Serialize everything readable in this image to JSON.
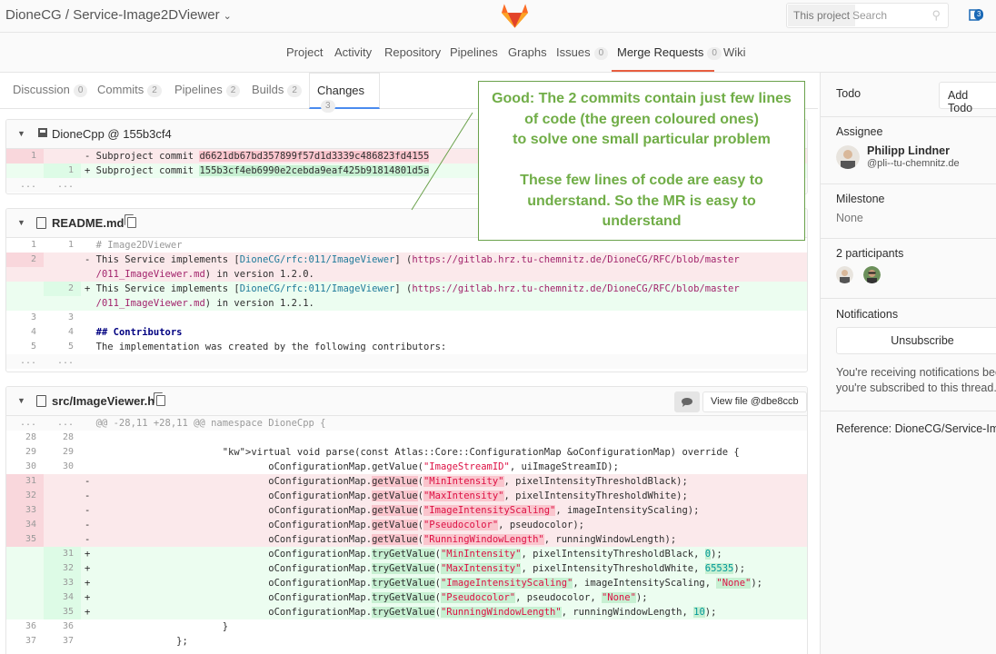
{
  "header": {
    "project_path": "DioneCG / Service-Image2DViewer",
    "scope_label": "This project",
    "search_placeholder": "Search",
    "todo_count": "3"
  },
  "project_nav": {
    "items": [
      {
        "label": "Project"
      },
      {
        "label": "Activity"
      },
      {
        "label": "Repository"
      },
      {
        "label": "Pipelines"
      },
      {
        "label": "Graphs"
      },
      {
        "label": "Issues",
        "count": "0"
      },
      {
        "label": "Merge Requests",
        "count": "0"
      },
      {
        "label": "Wiki"
      }
    ]
  },
  "tabs": [
    {
      "label": "Discussion",
      "count": "0"
    },
    {
      "label": "Commits",
      "count": "2"
    },
    {
      "label": "Pipelines",
      "count": "2"
    },
    {
      "label": "Builds",
      "count": "2"
    },
    {
      "label": "Changes",
      "count": "3"
    }
  ],
  "files": [
    {
      "name": "DioneCpp @ 155b3cf4",
      "lines": [
        {
          "t": "old",
          "o": "1",
          "n": "",
          "pre": "- Subproject commit ",
          "hl": "d6621db67bd357899f57d1d3339c486823fd4155"
        },
        {
          "t": "new",
          "o": "",
          "n": "1",
          "pre": "+ Subproject commit ",
          "hl": "155b3cf4eb6990e2cebda9eaf425b91814801d5a"
        },
        {
          "t": "fold",
          "o": "...",
          "n": "..."
        }
      ]
    },
    {
      "name": "README.md",
      "lines": [
        {
          "o": "1",
          "n": "1",
          "text": "  # Image2DViewer"
        },
        {
          "o": "2",
          "n": "",
          "text": "- This Service implements [DioneCG/rfc:011/ImageViewer] (https://gitlab.hrz.tu-chemnitz.de/DioneCG/RFC/blob/master"
        },
        {
          "o": "",
          "n": "",
          "text": "  /011_ImageViewer.md) in version 1.2.0."
        },
        {
          "o": "",
          "n": "2",
          "text": "+ This Service implements [DioneCG/rfc:011/ImageViewer] (https://gitlab.hrz.tu-chemnitz.de/DioneCG/RFC/blob/master"
        },
        {
          "o": "",
          "n": "",
          "text": "  /011_ImageViewer.md) in version 1.2.1."
        },
        {
          "o": "3",
          "n": "3",
          "text": ""
        },
        {
          "o": "4",
          "n": "4",
          "text": "  ## Contributors"
        },
        {
          "o": "5",
          "n": "5",
          "text": "  The implementation was created by the following contributors:"
        },
        {
          "o": "...",
          "n": "...",
          "text": ""
        }
      ]
    },
    {
      "name": "src/ImageViewer.h",
      "view_label": "View file @dbe8ccb",
      "lines": [
        {
          "o": "...",
          "n": "...",
          "text": "  @@ -28,11 +28,11 @@ namespace DioneCpp {"
        },
        {
          "o": "28",
          "n": "28",
          "text": ""
        },
        {
          "o": "29",
          "n": "29",
          "text": "                        virtual void parse(const Atlas::Core::ConfigurationMap &oConfigurationMap) override {"
        },
        {
          "o": "30",
          "n": "30",
          "text": "                                oConfigurationMap.getValue(\"ImageStreamID\", uiImageStreamID);"
        },
        {
          "o": "31",
          "n": "",
          "text": "-                               oConfigurationMap.getValue(\"MinIntensity\", pixelIntensityThresholdBlack);"
        },
        {
          "o": "32",
          "n": "",
          "text": "-                               oConfigurationMap.getValue(\"MaxIntensity\", pixelIntensityThresholdWhite);"
        },
        {
          "o": "33",
          "n": "",
          "text": "-                               oConfigurationMap.getValue(\"ImageIntensityScaling\", imageIntensityScaling);"
        },
        {
          "o": "34",
          "n": "",
          "text": "-                               oConfigurationMap.getValue(\"Pseudocolor\", pseudocolor);"
        },
        {
          "o": "35",
          "n": "",
          "text": "-                               oConfigurationMap.getValue(\"RunningWindowLength\", runningWindowLength);"
        },
        {
          "o": "",
          "n": "31",
          "text": "+                               oConfigurationMap.tryGetValue(\"MinIntensity\", pixelIntensityThresholdBlack, 0);"
        },
        {
          "o": "",
          "n": "32",
          "text": "+                               oConfigurationMap.tryGetValue(\"MaxIntensity\", pixelIntensityThresholdWhite, 65535);"
        },
        {
          "o": "",
          "n": "33",
          "text": "+                               oConfigurationMap.tryGetValue(\"ImageIntensityScaling\", imageIntensityScaling, \"None\");"
        },
        {
          "o": "",
          "n": "34",
          "text": "+                               oConfigurationMap.tryGetValue(\"Pseudocolor\", pseudocolor, \"None\");"
        },
        {
          "o": "",
          "n": "35",
          "text": "+                               oConfigurationMap.tryGetValue(\"RunningWindowLength\", runningWindowLength, 10);"
        },
        {
          "o": "36",
          "n": "36",
          "text": "                        }"
        },
        {
          "o": "37",
          "n": "37",
          "text": "                };"
        }
      ]
    }
  ],
  "sidebar": {
    "todo_label": "Todo",
    "add_todo": "Add Todo",
    "assignee_label": "Assignee",
    "assignee_name": "Philipp Lindner",
    "assignee_handle": "@pli--tu-chemnitz.de",
    "milestone_label": "Milestone",
    "milestone_value": "None",
    "participants_label": "2 participants",
    "notifications_label": "Notifications",
    "unsubscribe": "Unsubscribe",
    "notif_text_1": "You're receiving notifications because",
    "notif_text_2": "you're subscribed to this thread.",
    "reference": "Reference: DioneCG/Service-Ima..."
  },
  "callout": {
    "lines": [
      "Good: The 2 commits contain just few lines",
      "of code (the green coloured ones)",
      "to solve one small particular problem",
      "",
      "These few lines of code are easy to",
      "understand. So the MR is easy to",
      "understand"
    ]
  },
  "colors": {
    "callout_text": "#70ad47",
    "callout_border": "#6ba24c",
    "active_tab_underline": "#4a8bee",
    "mr_nav_underline": "#e75e40",
    "removed_line_bg": "#fbe9eb",
    "added_line_bg": "#ecfdf0"
  }
}
